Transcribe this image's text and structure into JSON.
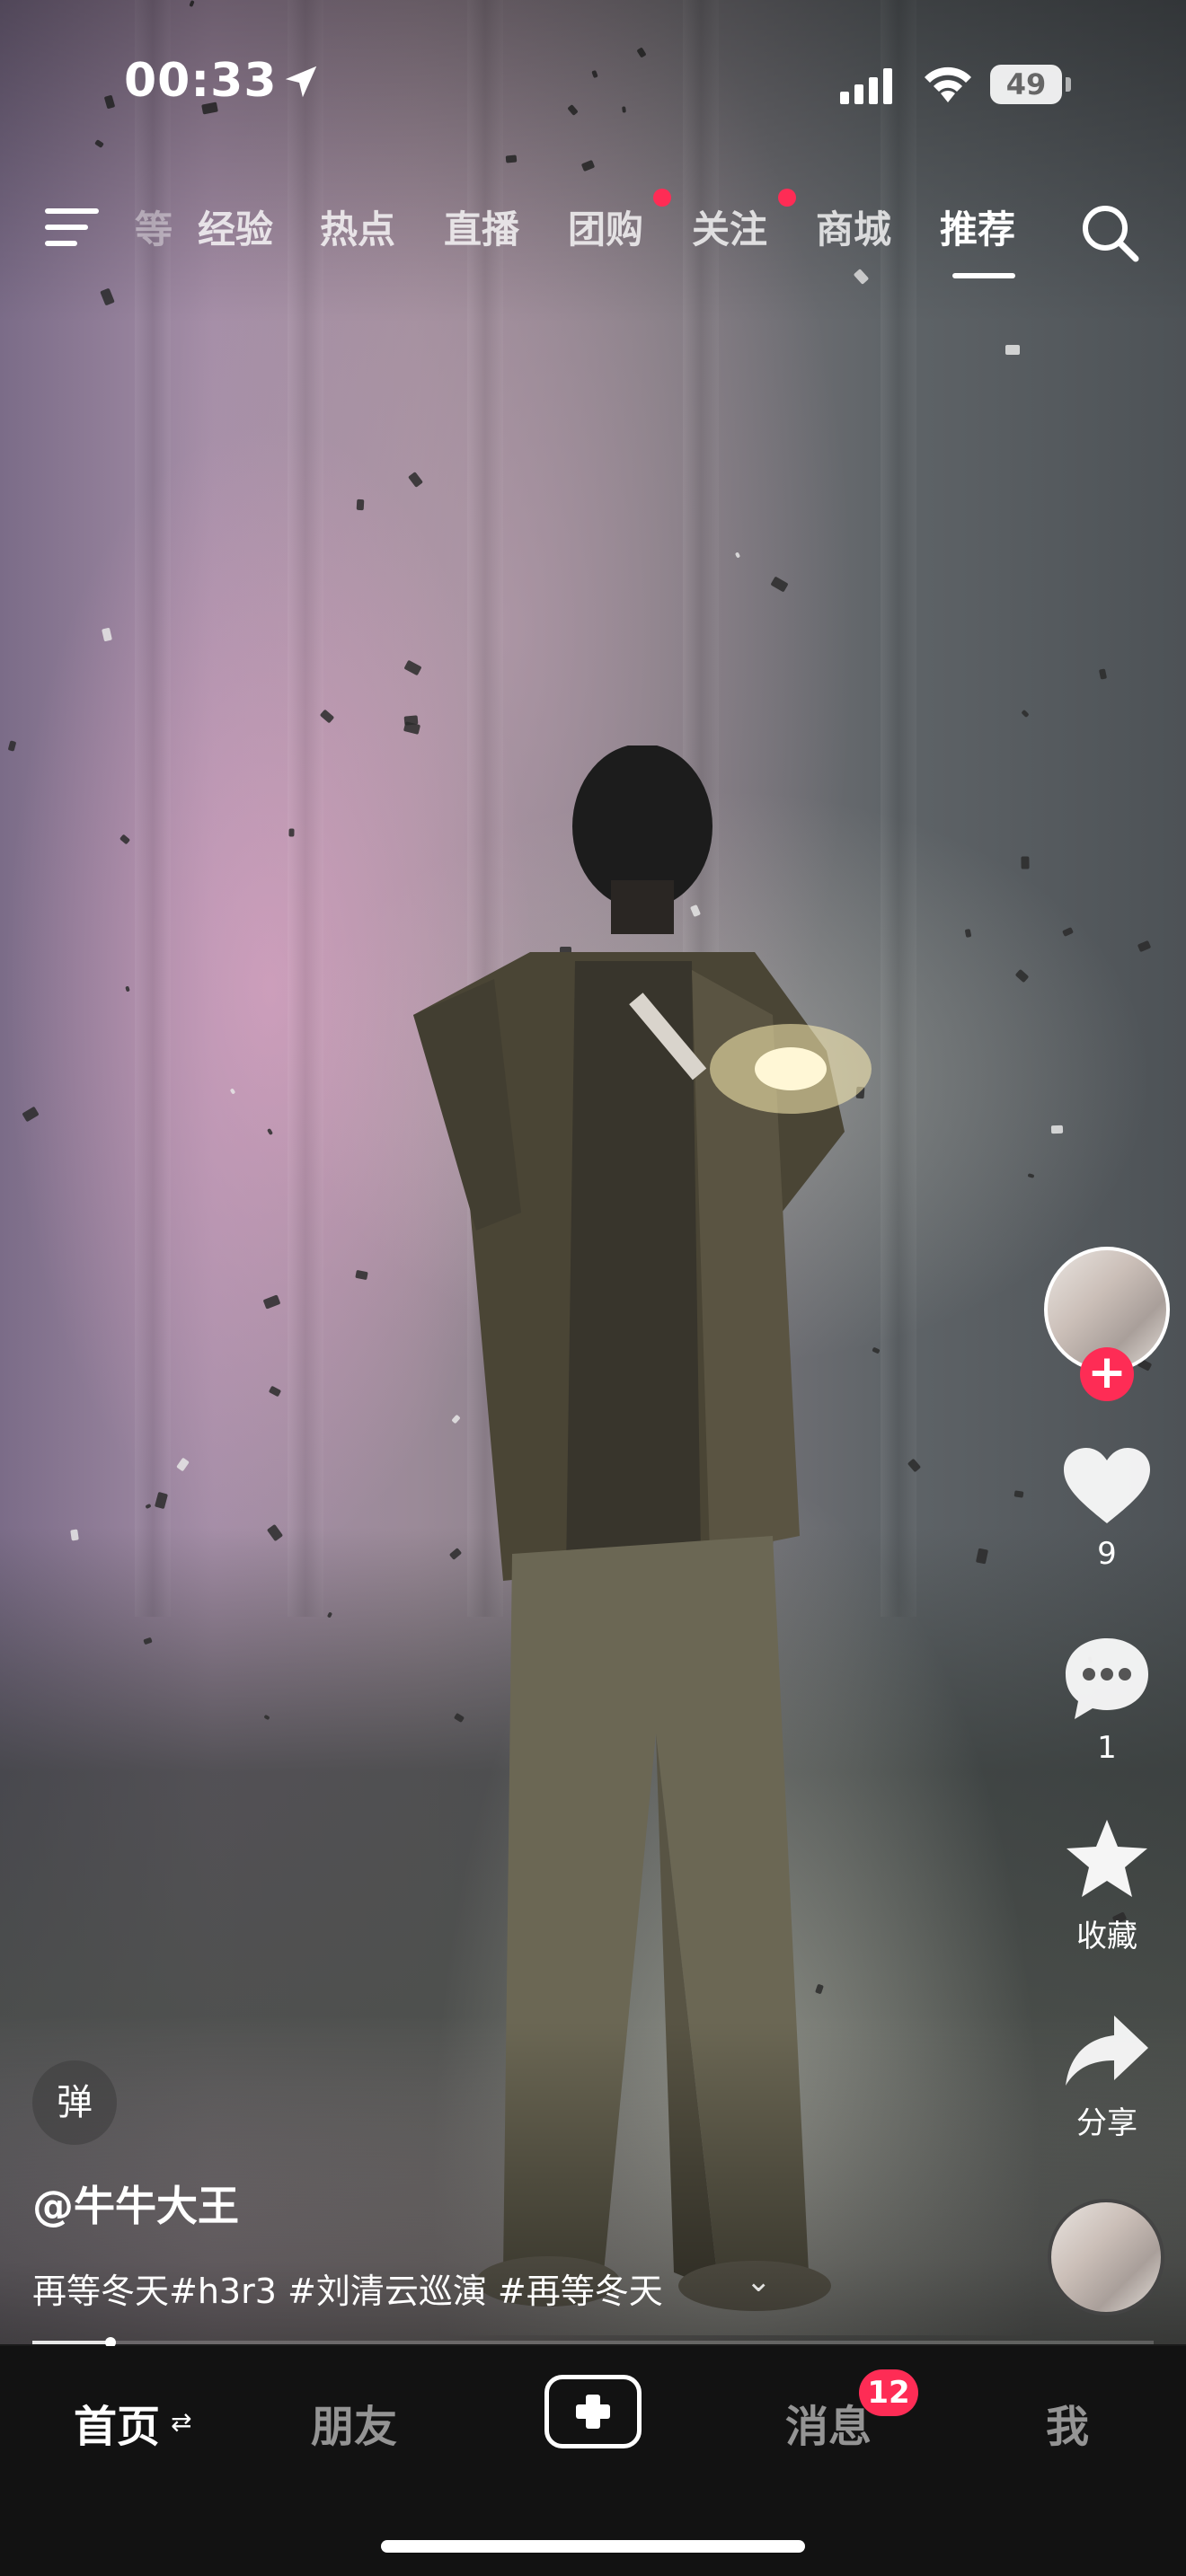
{
  "status_bar": {
    "time": "00:33",
    "battery": "49"
  },
  "top_nav": {
    "tabs": [
      {
        "label": "经验",
        "dot": false
      },
      {
        "label": "热点",
        "dot": false
      },
      {
        "label": "直播",
        "dot": false
      },
      {
        "label": "团购",
        "dot": true
      },
      {
        "label": "关注",
        "dot": true
      },
      {
        "label": "商城",
        "dot": false
      },
      {
        "label": "推荐",
        "dot": false,
        "active": true
      }
    ],
    "partial_tab": "等"
  },
  "actions": {
    "likes": "9",
    "comments": "1",
    "favorite_label": "收藏",
    "share_label": "分享"
  },
  "video": {
    "danmu_label": "弹",
    "author": "@牛牛大王",
    "caption": "再等冬天#h3r3 #刘清云巡演 #再等冬天",
    "expand_label": "⌄",
    "progress": 0.07
  },
  "bottom_nav": {
    "home": "首页",
    "friends": "朋友",
    "messages": "消息",
    "message_badge": "12",
    "me": "我"
  },
  "colors": {
    "accent": "#fe2c55",
    "nav_bg": "#121212"
  }
}
